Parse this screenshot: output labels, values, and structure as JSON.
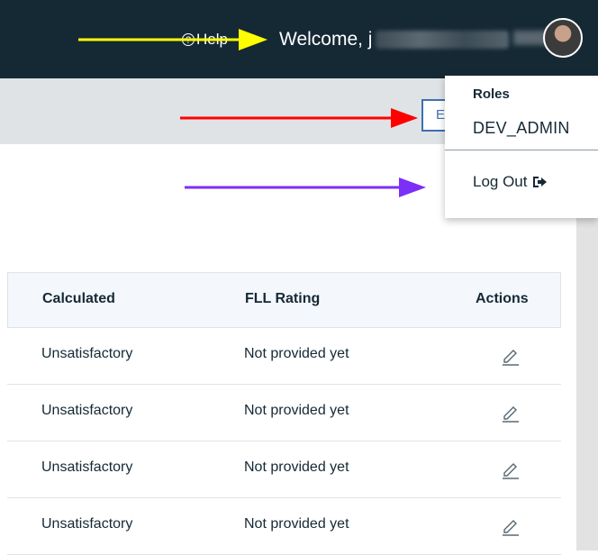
{
  "header": {
    "help_label": "Help",
    "welcome_text": "Welcome, j"
  },
  "toolbar": {
    "export_label": "E"
  },
  "table": {
    "columns": [
      "Calculated",
      "FLL Rating",
      "Actions"
    ],
    "rows": [
      {
        "calculated": "Unsatisfactory",
        "fll_rating": "Not provided yet"
      },
      {
        "calculated": "Unsatisfactory",
        "fll_rating": "Not provided yet"
      },
      {
        "calculated": "Unsatisfactory",
        "fll_rating": "Not provided yet"
      },
      {
        "calculated": "Unsatisfactory",
        "fll_rating": "Not provided yet"
      }
    ]
  },
  "user_menu": {
    "heading": "Roles",
    "role": "DEV_ADMIN",
    "logout_label": "Log Out"
  },
  "icons": {
    "help": "question-circle-icon",
    "edit": "pencil-icon",
    "logout": "sign-out-icon"
  },
  "colors": {
    "header_bg": "#152935",
    "toolbar_bg": "#dfe3e6",
    "accent": "#3d70b2",
    "arrow_yellow": "#ffff00",
    "arrow_red": "#ff0000",
    "arrow_purple": "#7b2ff7"
  }
}
